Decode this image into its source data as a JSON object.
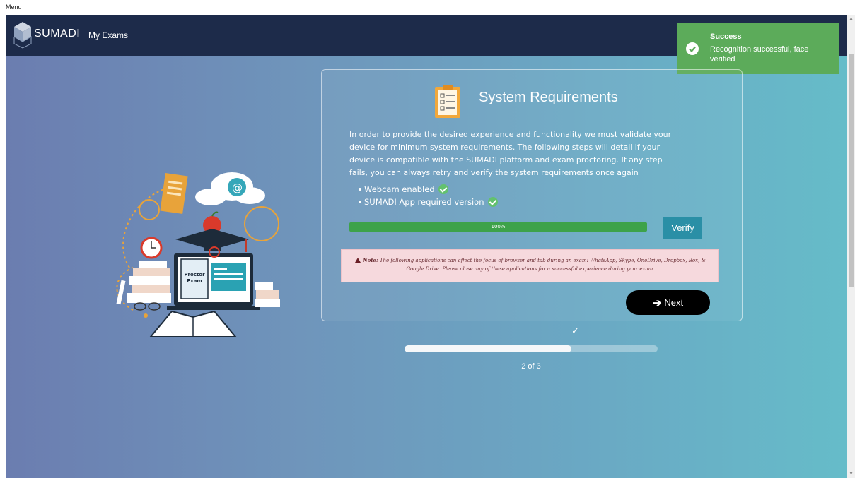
{
  "window": {
    "menu_label": "Menu"
  },
  "header": {
    "brand": "SUMADI",
    "nav_my_exams": "My Exams"
  },
  "toast": {
    "title": "Success",
    "message": "Recognition successful, face verified",
    "color": "#5cab5a"
  },
  "illustration": {
    "badge_line1": "Proctor",
    "badge_line2": "Exam"
  },
  "card": {
    "title": "System Requirements",
    "description": "In order to provide the desired experience and functionality we must validate your device for minimum system requirements. The following steps will detail if your device is compatible with the SUMADI platform and exam proctoring. If any step fails, you can always retry and verify the system requirements once again",
    "requirements": [
      {
        "label": "Webcam enabled",
        "status": "check-icon"
      },
      {
        "label": "SUMADI App required version",
        "status": "check-icon"
      }
    ],
    "progress": {
      "value": 100,
      "label": "100%"
    },
    "verify_label": "Verify",
    "note_label": "Note:",
    "note_text": "The following applications can affect the focus of browser and tab during an exam: WhatsApp, Skype, OneDrive, Dropbox, Box, & Google Drive. Please close any of these applications for a successful experience during your exam.",
    "next_label": "Next"
  },
  "stepper": {
    "current": 2,
    "total": 3,
    "fraction": 0.66,
    "label": "2 of 3",
    "done_icon": "checkmark-icon"
  },
  "colors": {
    "header_bg": "#1d2b4a",
    "progress_green": "#3da24a",
    "verify_bg": "#2a8fa6",
    "note_bg": "#f6d9dd"
  }
}
